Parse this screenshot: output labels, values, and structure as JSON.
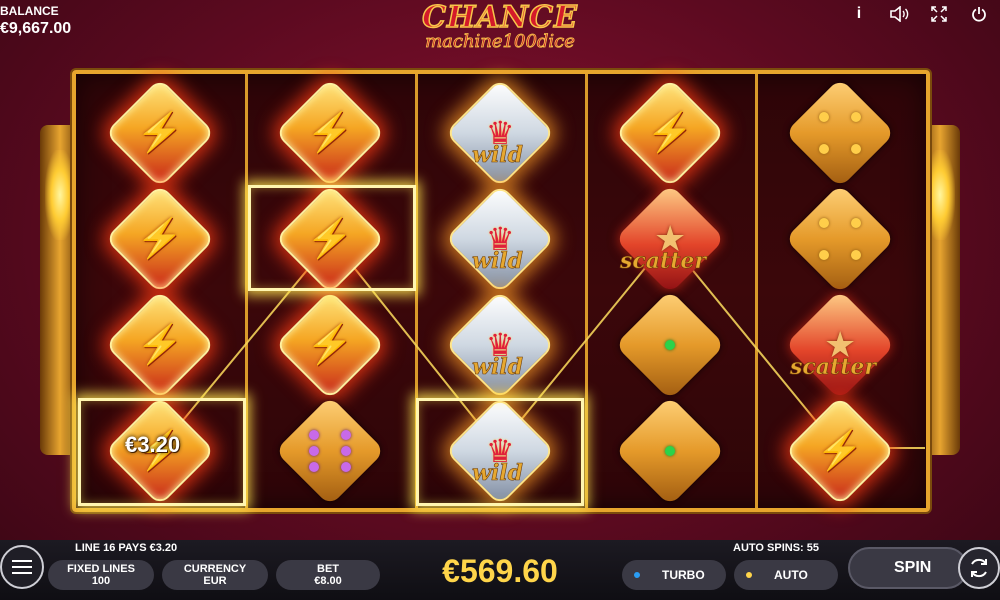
{
  "header": {
    "balance_label": "BALANCE",
    "balance_value": "€9,667.00",
    "logo_line1": "CHANCE",
    "logo_line2": "machine100dice"
  },
  "top_icons": [
    "info-icon",
    "sound-icon",
    "fullscreen-icon",
    "power-icon"
  ],
  "reels": [
    [
      "bolt",
      "bolt",
      "bolt",
      "bolt"
    ],
    [
      "bolt",
      "bolt",
      "bolt",
      "dice-6-purple"
    ],
    [
      "wild",
      "wild",
      "wild",
      "wild"
    ],
    [
      "bolt",
      "scatter",
      "dice-1-green",
      "dice-1-green"
    ],
    [
      "dice-4-gold",
      "dice-4-gold",
      "scatter",
      "bolt"
    ]
  ],
  "symbol_labels": {
    "wild": "wild",
    "scatter": "scatter"
  },
  "win": {
    "amount_label": "€3.20",
    "line_info": "LINE 16 PAYS €3.20"
  },
  "bottom": {
    "fixed_lines_label": "FIXED LINES",
    "fixed_lines_value": "100",
    "currency_label": "CURRENCY",
    "currency_value": "EUR",
    "bet_label": "BET",
    "bet_value": "€8.00",
    "total_win": "€569.60",
    "auto_spins_info": "AUTO SPINS: 55",
    "turbo_label": "TURBO",
    "auto_label": "AUTO",
    "spin_label": "SPIN"
  },
  "colors": {
    "accent_gold": "#ffd54a",
    "frame_gold": "#e7a52d",
    "turbo_dot": "#2a9df4",
    "auto_dot": "#ffd54a"
  }
}
